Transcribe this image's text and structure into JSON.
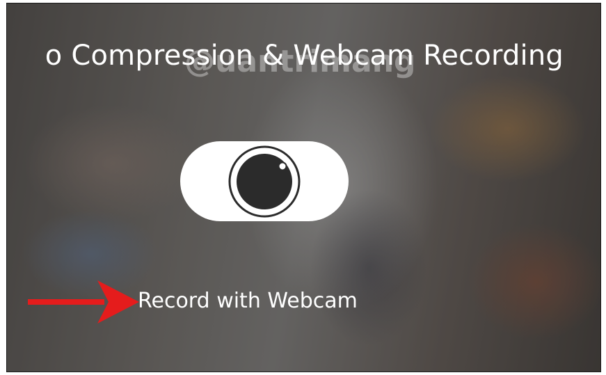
{
  "header": {
    "title": "o Compression & Webcam Recording"
  },
  "watermark": {
    "text": "@uantrimang"
  },
  "record": {
    "icon": "camera-lens-icon",
    "label": "Record with Webcam"
  },
  "annotation": {
    "icon": "red-arrow-icon",
    "color": "#e51c1c"
  }
}
